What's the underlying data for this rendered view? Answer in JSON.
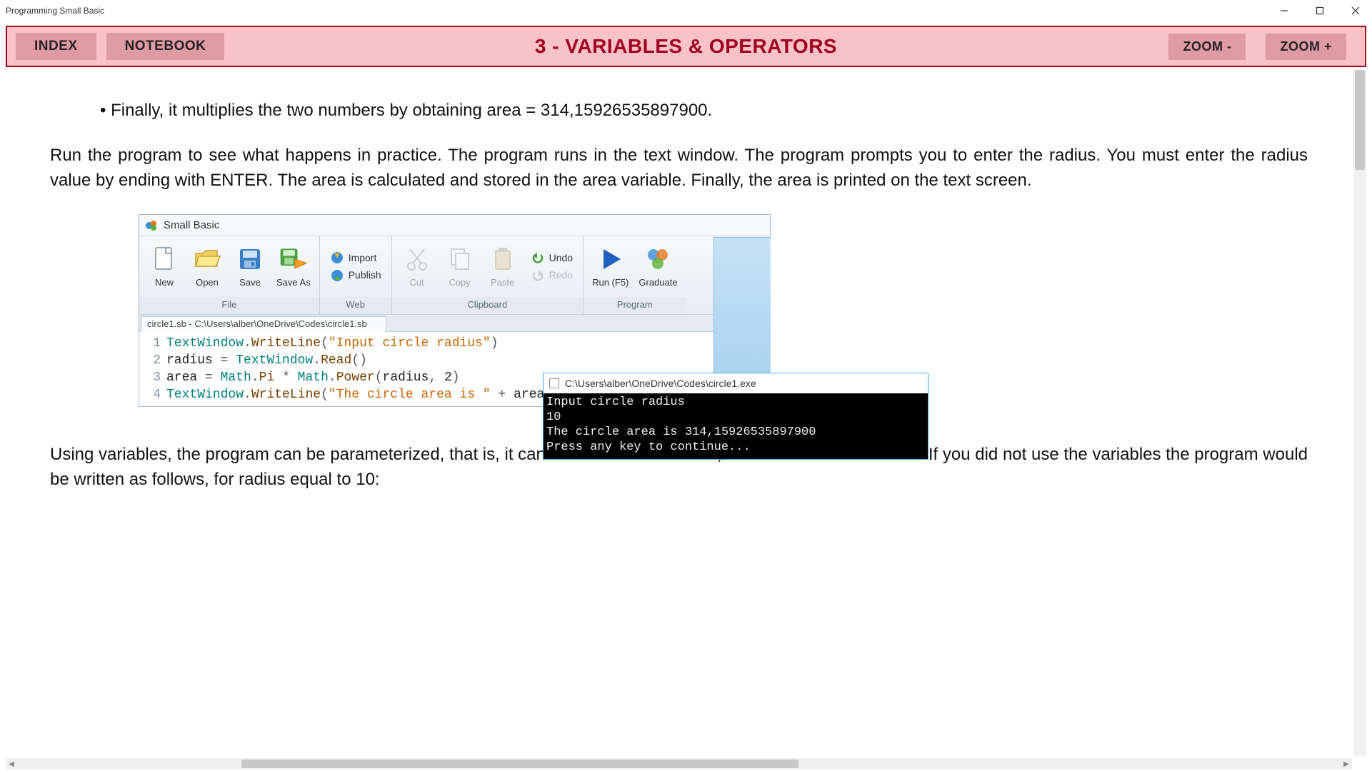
{
  "window": {
    "title": "Programming Small Basic"
  },
  "toolbar": {
    "index_label": "INDEX",
    "notebook_label": "NOTEBOOK",
    "header_title": "3 - VARIABLES & OPERATORS",
    "zoom_out_label": "ZOOM -",
    "zoom_in_label": "ZOOM +"
  },
  "content": {
    "bullet": "Finally, it multiplies the two numbers by obtaining area = 314,15926535897900.",
    "paragraph1": " Run the program to see what happens in practice. The program runs in the text window. The program prompts you to enter the radius. You must enter the radius value by ending with ENTER. The area is calculated and stored in the area variable. Finally, the area is printed on the text screen.",
    "paragraph2": "Using variables, the program can be parameterized, that is, it can be used several times, with different radius sizes. If you did not use the variables the program would be written as follows, for radius equal to 10:"
  },
  "sb": {
    "app_title": "Small Basic",
    "ribbon": {
      "file": {
        "group_label": "File",
        "new": "New",
        "open": "Open",
        "save": "Save",
        "save_as": "Save As"
      },
      "web": {
        "group_label": "Web",
        "import": "Import",
        "publish": "Publish"
      },
      "clipboard": {
        "group_label": "Clipboard",
        "cut": "Cut",
        "copy": "Copy",
        "paste": "Paste",
        "undo": "Undo",
        "redo": "Redo"
      },
      "program": {
        "group_label": "Program",
        "run": "Run (F5)",
        "graduate": "Graduate"
      }
    },
    "tab_title": "circle1.sb - C:\\Users\\alber\\OneDrive\\Codes\\circle1.sb",
    "code": {
      "lines": [
        {
          "n": "1",
          "type": "TextWindow",
          "dot1": ".",
          "method": "WriteLine",
          "paren_open": "(",
          "str": "\"Input circle radius\"",
          "paren_close": ")"
        },
        {
          "n": "2",
          "var": "radius",
          "eq": " = ",
          "type": "TextWindow",
          "dot1": ".",
          "method": "Read",
          "paren_open": "(",
          "paren_close": ")"
        },
        {
          "n": "3",
          "var": "area",
          "eq": " = ",
          "type": "Math",
          "dot1": ".",
          "prop": "Pi",
          "times": " * ",
          "type2": "Math",
          "dot2": ".",
          "method": "Power",
          "paren_open": "(",
          "arg1": "radius",
          "comma": ", ",
          "arg2": "2",
          "paren_close": ")"
        },
        {
          "n": "4",
          "type": "TextWindow",
          "dot1": ".",
          "method": "WriteLine",
          "paren_open": "(",
          "str": "\"The circle area is \"",
          "plus": " + ",
          "var2": "area",
          "paren_close": ")"
        }
      ]
    }
  },
  "console": {
    "title": "C:\\Users\\alber\\OneDrive\\Codes\\circle1.exe",
    "lines": [
      "Input circle radius",
      "10",
      "The circle area is 314,15926535897900",
      "Press any key to continue..."
    ]
  }
}
